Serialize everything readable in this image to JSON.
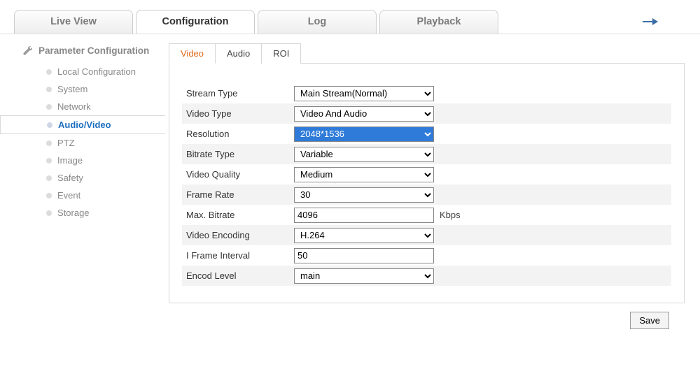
{
  "top_tabs": {
    "live_view": "Live View",
    "configuration": "Configuration",
    "log": "Log",
    "playback": "Playback"
  },
  "sidebar": {
    "title": "Parameter Configuration",
    "items": [
      {
        "label": "Local Configuration"
      },
      {
        "label": "System"
      },
      {
        "label": "Network"
      },
      {
        "label": "Audio/Video"
      },
      {
        "label": "PTZ"
      },
      {
        "label": "Image"
      },
      {
        "label": "Safety"
      },
      {
        "label": "Event"
      },
      {
        "label": "Storage"
      }
    ]
  },
  "subtabs": {
    "video": "Video",
    "audio": "Audio",
    "roi": "ROI"
  },
  "form": {
    "stream_type": {
      "label": "Stream Type",
      "value": "Main Stream(Normal)"
    },
    "video_type": {
      "label": "Video Type",
      "value": "Video And Audio"
    },
    "resolution": {
      "label": "Resolution",
      "value": "2048*1536"
    },
    "bitrate_type": {
      "label": "Bitrate Type",
      "value": "Variable"
    },
    "video_quality": {
      "label": "Video Quality",
      "value": "Medium"
    },
    "frame_rate": {
      "label": "Frame Rate",
      "value": "30"
    },
    "max_bitrate": {
      "label": "Max. Bitrate",
      "value": "4096",
      "unit": "Kbps"
    },
    "video_encoding": {
      "label": "Video Encoding",
      "value": "H.264"
    },
    "i_frame_interval": {
      "label": "I Frame Interval",
      "value": "50"
    },
    "encod_level": {
      "label": "Encod Level",
      "value": "main"
    }
  },
  "buttons": {
    "save": "Save"
  }
}
